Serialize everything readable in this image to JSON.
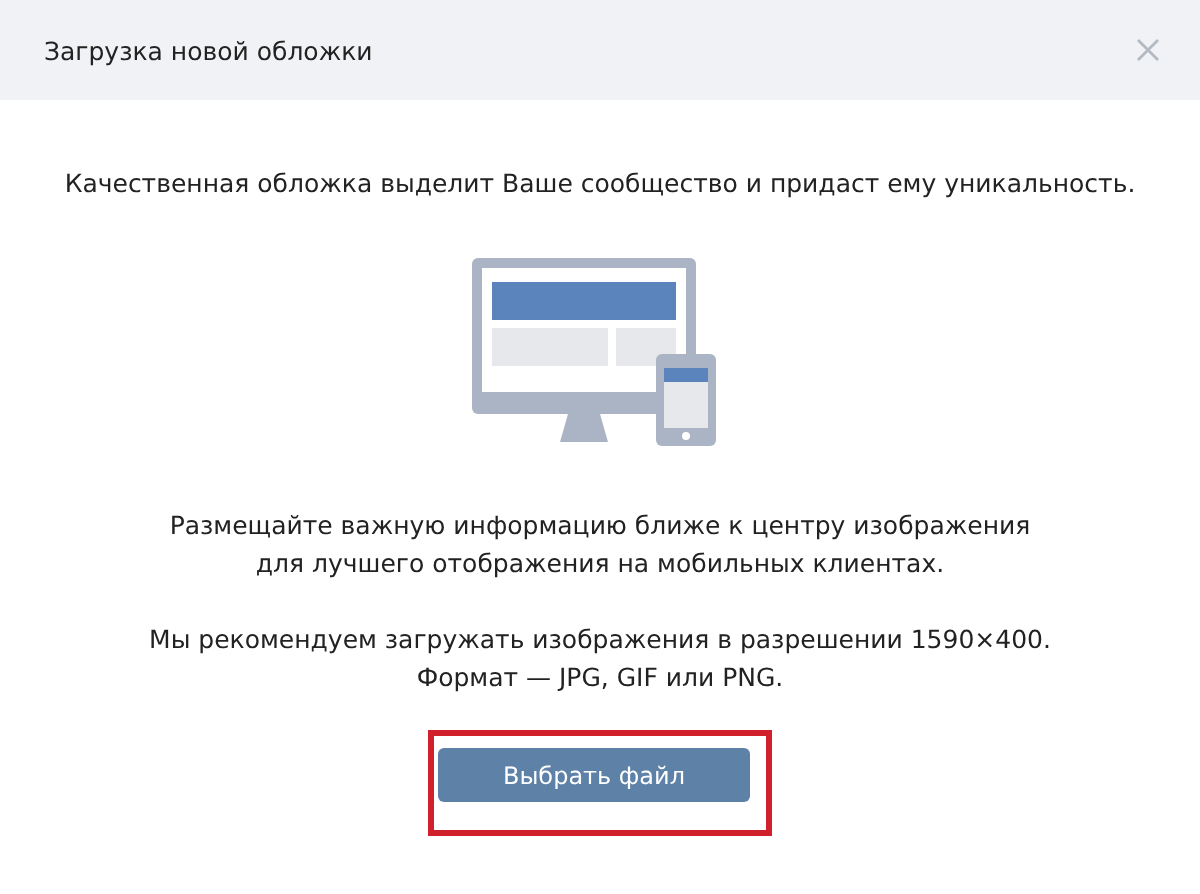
{
  "window": {
    "title": "Загрузка новой обложки"
  },
  "intro": "Качественная обложка выделит Ваше сообщество и придаст ему уникальность.",
  "paragraphs": [
    {
      "lines": [
        "Размещайте важную информацию ближе к центру изображения",
        "для лучшего отображения на мобильных клиентах."
      ]
    },
    {
      "lines": [
        "Мы рекомендуем загружать изображения в разрешении 1590×400.",
        "Формат — JPG, GIF или PNG."
      ]
    }
  ],
  "button": {
    "label": "Выбрать файл",
    "highlighted": true
  }
}
